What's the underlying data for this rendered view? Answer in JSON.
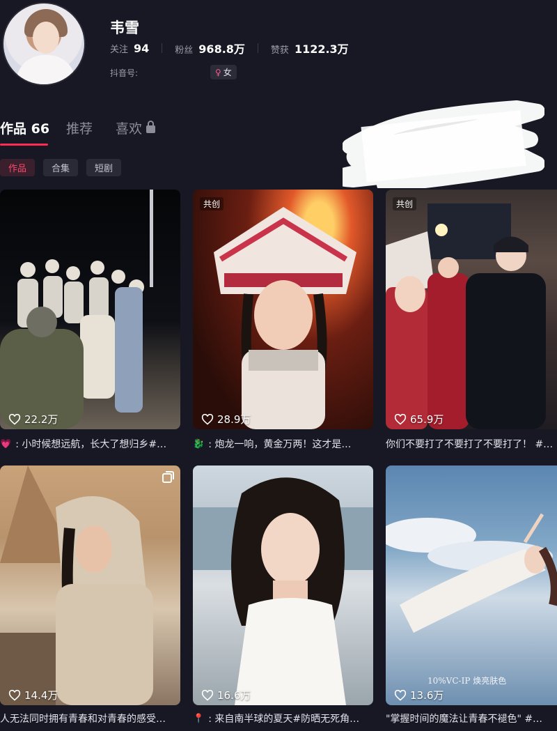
{
  "profile": {
    "name": "韦雪",
    "following_label": "关注",
    "following_value": "94",
    "fans_label": "粉丝",
    "fans_value": "968.8万",
    "likes_label": "赞获",
    "likes_value": "1122.3万",
    "douyin_id_label": "抖音号:",
    "gender_symbol": "♀",
    "gender_label": "女"
  },
  "tabs": {
    "works": "作品 66",
    "recommend": "推荐",
    "liked": "喜欢"
  },
  "chips": [
    "作品",
    "合集",
    "短剧"
  ],
  "videos": [
    {
      "badge": "",
      "likes": "22.2万",
      "caption_icon": "💗",
      "caption": ": 小时候想远航，长大了想归乡#…"
    },
    {
      "badge": "共创",
      "likes": "28.9万",
      "caption_icon": "🐉",
      "caption": ": 炮龙一响，黄金万两！这才是…"
    },
    {
      "badge": "共创",
      "likes": "65.9万",
      "caption_icon": "",
      "caption": "你们不要打了不要打了不要打了！ #…"
    },
    {
      "badge": "",
      "likes": "14.4万",
      "caption_icon": "",
      "caption": "人无法同时拥有青春和对青春的感受…"
    },
    {
      "badge": "",
      "likes": "16.6万",
      "caption_icon": "📍",
      "caption": ": 来自南半球的夏天#防晒无死角…"
    },
    {
      "badge": "",
      "likes": "13.6万",
      "caption_icon": "",
      "caption": "\"掌握时间的魔法让青春不褪色\" #…"
    }
  ],
  "overlay_text": {
    "video6": "10%VC-IP 焕亮肤色"
  },
  "colors": {
    "accent": "#fe2c55",
    "background": "#171823"
  }
}
